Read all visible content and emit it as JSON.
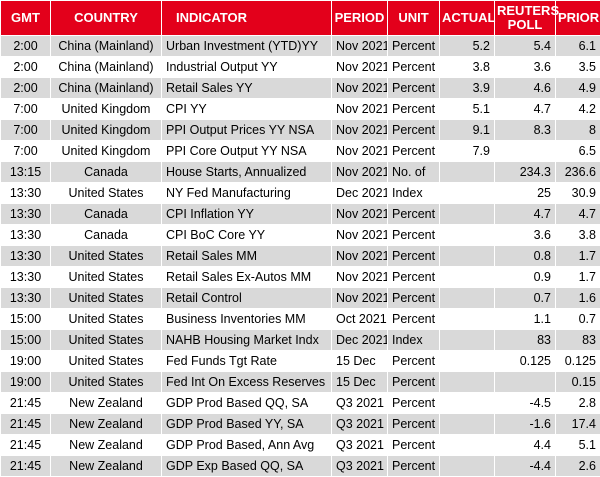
{
  "headers": [
    "GMT",
    "COUNTRY",
    "INDICATOR",
    "PERIOD",
    "UNIT",
    "ACTUAL",
    "REUTERS POLL",
    "PRIOR"
  ],
  "rows": [
    [
      "2:00",
      "China (Mainland)",
      "Urban Investment (YTD)YY",
      "Nov 2021",
      "Percent",
      "5.2",
      "5.4",
      "6.1"
    ],
    [
      "2:00",
      "China (Mainland)",
      "Industrial Output YY",
      "Nov 2021",
      "Percent",
      "3.8",
      "3.6",
      "3.5"
    ],
    [
      "2:00",
      "China (Mainland)",
      "Retail Sales YY",
      "Nov 2021",
      "Percent",
      "3.9",
      "4.6",
      "4.9"
    ],
    [
      "7:00",
      "United Kingdom",
      "CPI YY",
      "Nov 2021",
      "Percent",
      "5.1",
      "4.7",
      "4.2"
    ],
    [
      "7:00",
      "United Kingdom",
      "PPI Output Prices YY NSA",
      "Nov 2021",
      "Percent",
      "9.1",
      "8.3",
      "8"
    ],
    [
      "7:00",
      "United Kingdom",
      "PPI Core Output YY NSA",
      "Nov 2021",
      "Percent",
      "7.9",
      "",
      "6.5"
    ],
    [
      "13:15",
      "Canada",
      "House Starts, Annualized",
      "Nov 2021",
      "No. of",
      "",
      "234.3",
      "236.6"
    ],
    [
      "13:30",
      "United States",
      "NY Fed Manufacturing",
      "Dec 2021",
      "Index",
      "",
      "25",
      "30.9"
    ],
    [
      "13:30",
      "Canada",
      "CPI Inflation YY",
      "Nov 2021",
      "Percent",
      "",
      "4.7",
      "4.7"
    ],
    [
      "13:30",
      "Canada",
      "CPI BoC Core YY",
      "Nov 2021",
      "Percent",
      "",
      "3.6",
      "3.8"
    ],
    [
      "13:30",
      "United States",
      "Retail Sales MM",
      "Nov 2021",
      "Percent",
      "",
      "0.8",
      "1.7"
    ],
    [
      "13:30",
      "United States",
      "Retail Sales Ex-Autos MM",
      "Nov 2021",
      "Percent",
      "",
      "0.9",
      "1.7"
    ],
    [
      "13:30",
      "United States",
      "Retail Control",
      "Nov 2021",
      "Percent",
      "",
      "0.7",
      "1.6"
    ],
    [
      "15:00",
      "United States",
      "Business Inventories MM",
      "Oct 2021",
      "Percent",
      "",
      "1.1",
      "0.7"
    ],
    [
      "15:00",
      "United States",
      "NAHB Housing Market Indx",
      "Dec 2021",
      "Index",
      "",
      "83",
      "83"
    ],
    [
      "19:00",
      "United States",
      "Fed Funds Tgt Rate",
      "15 Dec",
      "Percent",
      "",
      "0.125",
      "0.125"
    ],
    [
      "19:00",
      "United States",
      "Fed Int On Excess Reserves",
      "15 Dec",
      "Percent",
      "",
      "",
      "0.15"
    ],
    [
      "21:45",
      "New Zealand",
      "GDP Prod Based QQ, SA",
      "Q3 2021",
      "Percent",
      "",
      "-4.5",
      "2.8"
    ],
    [
      "21:45",
      "New Zealand",
      "GDP Prod Based YY, SA",
      "Q3 2021",
      "Percent",
      "",
      "-1.6",
      "17.4"
    ],
    [
      "21:45",
      "New Zealand",
      "GDP Prod Based, Ann Avg",
      "Q3 2021",
      "Percent",
      "",
      "4.4",
      "5.1"
    ],
    [
      "21:45",
      "New Zealand",
      "GDP Exp Based QQ, SA",
      "Q3 2021",
      "Percent",
      "",
      "-4.4",
      "2.6"
    ]
  ],
  "colors": {
    "header_bg": "#e3001b",
    "header_text": "#ffffff",
    "row_alt": "#d9d9d9",
    "row_base": "#ffffff"
  }
}
